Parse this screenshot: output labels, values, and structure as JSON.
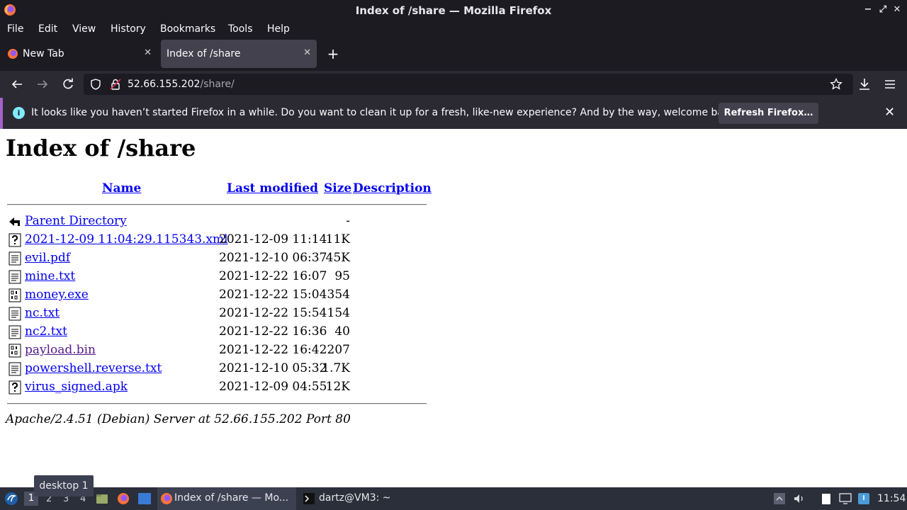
{
  "window": {
    "title": "Index of /share — Mozilla Firefox"
  },
  "menu": [
    "File",
    "Edit",
    "View",
    "History",
    "Bookmarks",
    "Tools",
    "Help"
  ],
  "tabs": [
    {
      "label": "New Tab",
      "active": false
    },
    {
      "label": "Index of /share",
      "active": true
    }
  ],
  "address_bar": {
    "host": "52.66.155.202",
    "path": "/share/"
  },
  "notification": {
    "message": "It looks like you haven’t started Firefox in a while. Do you want to clean it up for a fresh, like-new experience? And by the way, welcome back!",
    "button": "Refresh Firefox…"
  },
  "page": {
    "heading": "Index of /share",
    "columns": {
      "name": "Name",
      "last_modified": "Last modified",
      "size": "Size",
      "description": "Description"
    },
    "rows": [
      {
        "name": "Parent Directory",
        "date": "",
        "size": "-",
        "icon": "back-icon",
        "visited": false
      },
      {
        "name": "2021-12-09 11:04:29.115343.xml",
        "date": "2021-12-09 11:14",
        "size": "11K",
        "icon": "unknown-file-icon",
        "visited": false
      },
      {
        "name": "evil.pdf",
        "date": "2021-12-10 06:37",
        "size": "45K",
        "icon": "text-file-icon",
        "visited": false
      },
      {
        "name": "mine.txt",
        "date": "2021-12-22 16:07",
        "size": "95",
        "icon": "text-file-icon",
        "visited": false
      },
      {
        "name": "money.exe",
        "date": "2021-12-22 15:04",
        "size": "354",
        "icon": "binary-file-icon",
        "visited": false
      },
      {
        "name": "nc.txt",
        "date": "2021-12-22 15:54",
        "size": "154",
        "icon": "text-file-icon",
        "visited": false
      },
      {
        "name": "nc2.txt",
        "date": "2021-12-22 16:36",
        "size": "40",
        "icon": "text-file-icon",
        "visited": false
      },
      {
        "name": "payload.bin",
        "date": "2021-12-22 16:42",
        "size": "207",
        "icon": "binary-file-icon",
        "visited": true
      },
      {
        "name": "powershell.reverse.txt",
        "date": "2021-12-10 05:32",
        "size": "1.7K",
        "icon": "text-file-icon",
        "visited": false
      },
      {
        "name": "virus_signed.apk",
        "date": "2021-12-09 04:55",
        "size": "12K",
        "icon": "unknown-file-icon",
        "visited": false
      }
    ],
    "address": "Apache/2.4.51 (Debian) Server at 52.66.155.202 Port 80"
  },
  "taskbar": {
    "tooltip": "desktop 1",
    "workspaces": [
      "1",
      "2",
      "3",
      "4"
    ],
    "tasks": [
      {
        "label": "Index of /share — Mo..."
      },
      {
        "label": "dartz@VM3: ~"
      }
    ],
    "clock": "11:54"
  },
  "colors": {
    "chrome_dark": "#1c1b22",
    "toolbar": "#2b2a33",
    "active_tab": "#42414d",
    "link": "#0000ee",
    "visited_link": "#551a8b",
    "notification_accent": "#a362c8",
    "taskbar": "#2a2f3a"
  }
}
